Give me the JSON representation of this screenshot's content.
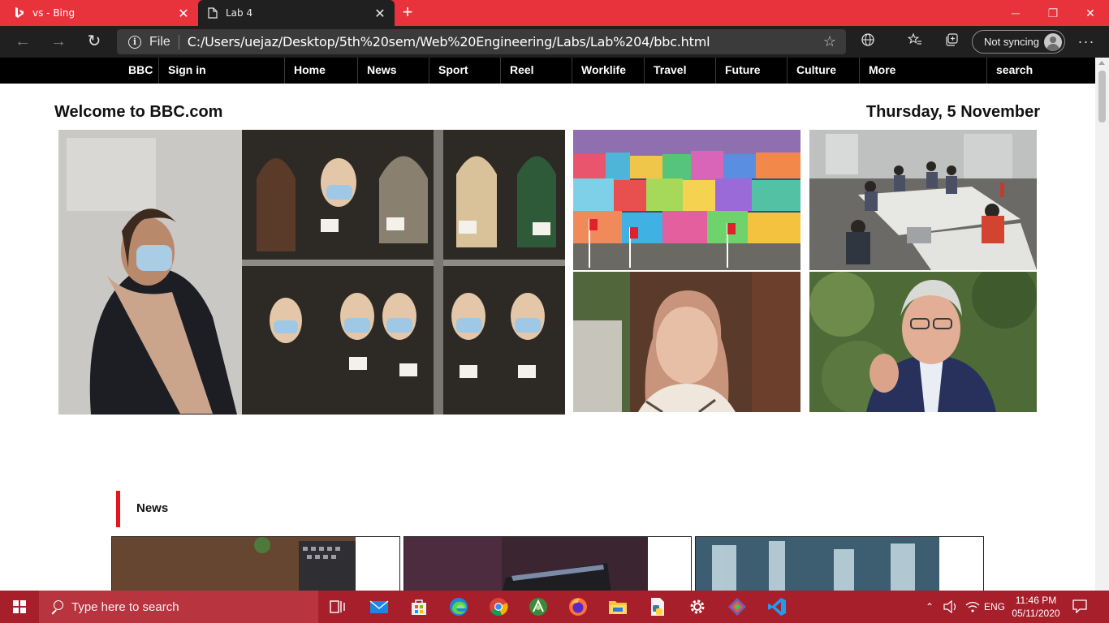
{
  "browser": {
    "tabs": [
      {
        "title": "vs - Bing",
        "active": false
      },
      {
        "title": "Lab 4",
        "active": true
      }
    ],
    "new_tab": "+",
    "omnibox": {
      "scheme_label": "File",
      "url": "C:/Users/uejaz/Desktop/5th%20sem/Web%20Engineering/Labs/Lab%204/bbc.html"
    },
    "profile_label": "Not syncing",
    "more_label": "···"
  },
  "page": {
    "nav": [
      {
        "label": "BBC"
      },
      {
        "label": "Sign in"
      },
      {
        "label": "Home"
      },
      {
        "label": "News"
      },
      {
        "label": "Sport"
      },
      {
        "label": "Reel"
      },
      {
        "label": "Worklife"
      },
      {
        "label": "Travel"
      },
      {
        "label": "Future"
      },
      {
        "label": "Culture"
      },
      {
        "label": "More"
      },
      {
        "label": "search"
      }
    ],
    "welcome": "Welcome to BBC.com",
    "date": "Thursday, 5 November",
    "section_title": "News"
  },
  "taskbar": {
    "search_placeholder": "Type here to search",
    "language": "ENG",
    "time": "11:46 PM",
    "date": "05/11/2020"
  },
  "colors": {
    "tab_strip": "#e8323c",
    "taskbar": "#a71f2b",
    "bbc_nav": "#000000",
    "section_marker": "#e5141e"
  }
}
